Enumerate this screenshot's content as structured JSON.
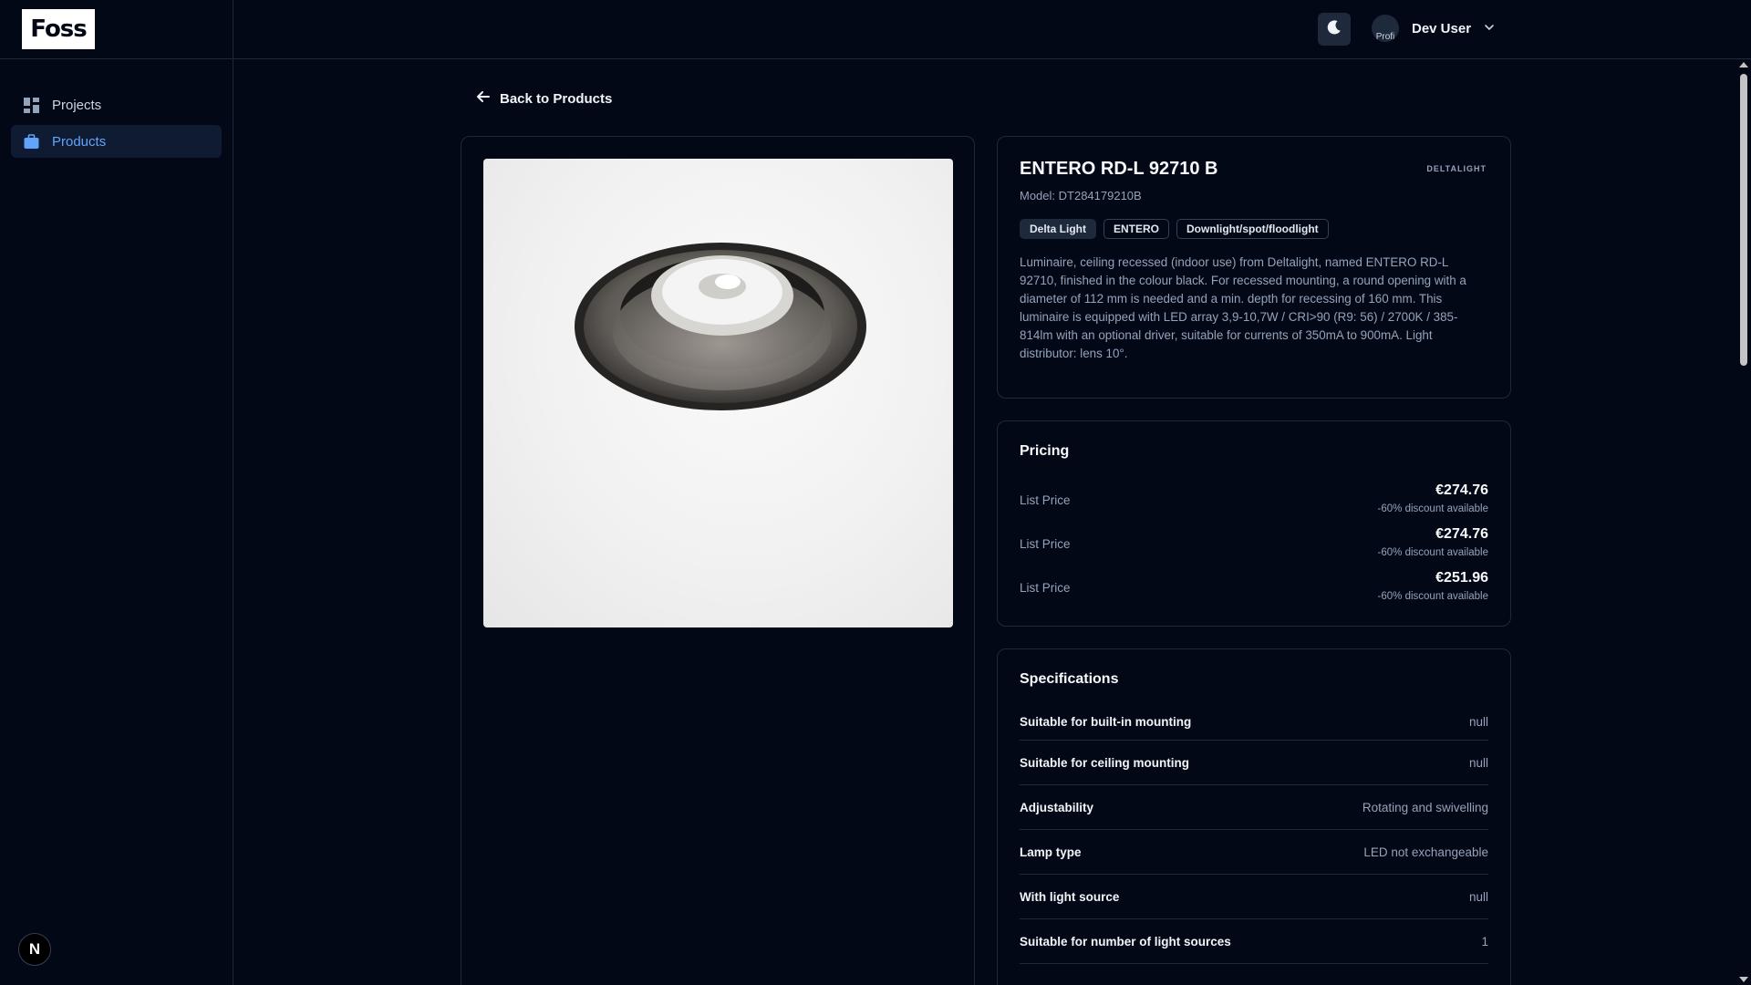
{
  "app": {
    "logo_text": "Foss",
    "bottom_badge": "N"
  },
  "sidebar": {
    "items": [
      {
        "label": "Projects",
        "icon": "grid-icon",
        "active": false
      },
      {
        "label": "Products",
        "icon": "briefcase-icon",
        "active": true
      }
    ]
  },
  "header": {
    "user_name": "Dev User",
    "avatar_alt": "Profi",
    "theme_icon": "moon-icon"
  },
  "back": {
    "label": "Back to Products"
  },
  "product": {
    "title": "ENTERO RD-L 92710 B",
    "model": "Model: DT284179210B",
    "brand_logo": "DELTALIGHT",
    "tags": [
      "Delta Light",
      "ENTERO",
      "Downlight/spot/floodlight"
    ],
    "description": "Luminaire, ceiling recessed (indoor use) from Deltalight, named ENTERO RD-L 92710, finished in the colour black. For recessed mounting, a round opening with a diameter of 112 mm is needed and a min. depth for recessing of 160 mm. This luminaire is equipped with LED array 3,9-10,7W / CRI>90 (R9: 56) / 2700K / 385-814lm with an optional driver, suitable for currents of 350mA to 900mA. Light distributor: lens 10°."
  },
  "pricing": {
    "title": "Pricing",
    "rows": [
      {
        "label": "List Price",
        "value": "€274.76",
        "discount": "-60% discount available"
      },
      {
        "label": "List Price",
        "value": "€274.76",
        "discount": "-60% discount available"
      },
      {
        "label": "List Price",
        "value": "€251.96",
        "discount": "-60% discount available"
      }
    ]
  },
  "specifications": {
    "title": "Specifications",
    "rows": [
      {
        "label": "Suitable for built-in mounting",
        "value": "null"
      },
      {
        "label": "Suitable for ceiling mounting",
        "value": "null"
      },
      {
        "label": "Adjustability",
        "value": "Rotating and swivelling"
      },
      {
        "label": "Lamp type",
        "value": "LED not exchangeable"
      },
      {
        "label": "With light source",
        "value": "null"
      },
      {
        "label": "Suitable for number of light sources",
        "value": "1"
      }
    ]
  },
  "colors": {
    "background": "#030817",
    "accent": "#60a5fa",
    "border": "#1e293b",
    "muted": "#94a3b8"
  }
}
